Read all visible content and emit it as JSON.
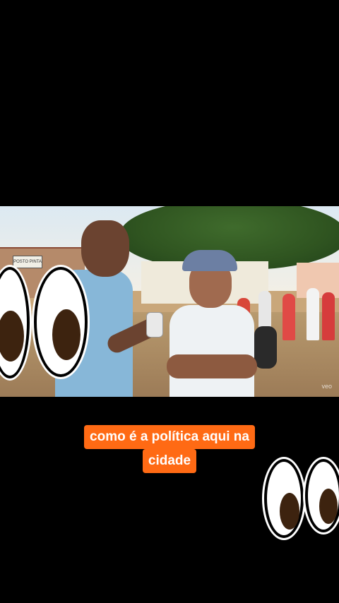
{
  "video": {
    "watermark": "veo",
    "sign_text": "POSTO PINTA"
  },
  "caption": {
    "line1": "como é a política aqui na",
    "line2": "cidade"
  },
  "overlays": {
    "eyes_left": "eyes-sticker",
    "eyes_right": "eyes-sticker"
  },
  "colors": {
    "caption_bg": "#ff6a14",
    "caption_text": "#ffffff",
    "background": "#000000"
  }
}
